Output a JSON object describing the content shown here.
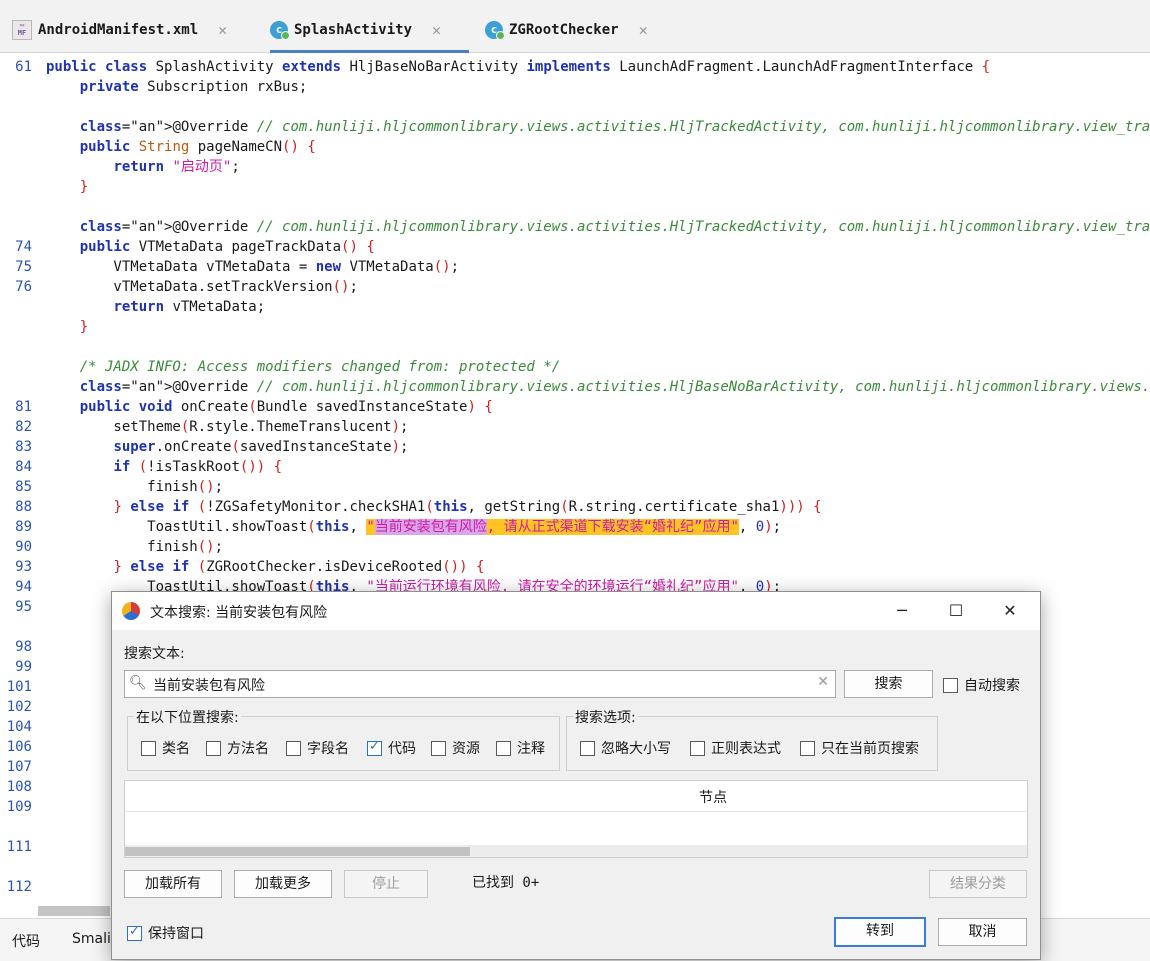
{
  "tabs": [
    {
      "label": "AndroidManifest.xml",
      "icon": "manifest-file-icon",
      "active": false
    },
    {
      "label": "SplashActivity",
      "icon": "class-file-icon",
      "active": true
    },
    {
      "label": "ZGRootChecker",
      "icon": "class-file-icon",
      "active": false
    }
  ],
  "code": {
    "lines": [
      {
        "n": "61",
        "t": "public class SplashActivity extends HljBaseNoBarActivity implements LaunchAdFragment.LaunchAdFragmentInterface {"
      },
      {
        "n": "",
        "t": "    private Subscription rxBus;"
      },
      {
        "n": "",
        "t": ""
      },
      {
        "n": "",
        "t": "    @Override // com.hunliji.hljcommonlibrary.views.activities.HljTrackedActivity, com.hunliji.hljcommonlibrary.view_tracke"
      },
      {
        "n": "",
        "t": "    public String pageNameCN() {"
      },
      {
        "n": "",
        "t": "        return \"启动页\";"
      },
      {
        "n": "",
        "t": "    }"
      },
      {
        "n": "",
        "t": ""
      },
      {
        "n": "",
        "t": "    @Override // com.hunliji.hljcommonlibrary.views.activities.HljTrackedActivity, com.hunliji.hljcommonlibrary.view_tracke"
      },
      {
        "n": "74",
        "t": "    public VTMetaData pageTrackData() {"
      },
      {
        "n": "75",
        "t": "        VTMetaData vTMetaData = new VTMetaData();"
      },
      {
        "n": "76",
        "t": "        vTMetaData.setTrackVersion();"
      },
      {
        "n": "",
        "t": "        return vTMetaData;"
      },
      {
        "n": "",
        "t": "    }"
      },
      {
        "n": "",
        "t": ""
      },
      {
        "n": "",
        "t": "    /* JADX INFO: Access modifiers changed from: protected */"
      },
      {
        "n": "",
        "t": "    @Override // com.hunliji.hljcommonlibrary.views.activities.HljBaseNoBarActivity, com.hunliji.hljcommonlibrary.views.act"
      },
      {
        "n": "81",
        "t": "    public void onCreate(Bundle savedInstanceState) {"
      },
      {
        "n": "82",
        "t": "        setTheme(R.style.ThemeTranslucent);"
      },
      {
        "n": "83",
        "t": "        super.onCreate(savedInstanceState);"
      },
      {
        "n": "84",
        "t": "        if (!isTaskRoot()) {"
      },
      {
        "n": "85",
        "t": "            finish();"
      },
      {
        "n": "88",
        "t": "        } else if (!ZGSafetyMonitor.checkSHA1(this, getString(R.string.certificate_sha1))) {"
      },
      {
        "n": "89",
        "t": "            ToastUtil.showToast(this, \"当前安装包有风险, 请从正式渠道下载安装“婚礼纪”应用\", 0);"
      },
      {
        "n": "90",
        "t": "            finish();"
      },
      {
        "n": "93",
        "t": "        } else if (ZGRootChecker.isDeviceRooted()) {"
      },
      {
        "n": "94",
        "t": "            ToastUtil.showToast(this, \"当前运行环境有风险, 请在安全的环境运行“婚礼纪”应用\", 0);"
      },
      {
        "n": "95",
        "t": ""
      }
    ],
    "gutter_only": [
      "98",
      "99",
      "101",
      "102",
      "104",
      "106",
      "107",
      "108",
      "109",
      "111",
      "112"
    ]
  },
  "bottom_tabs": [
    "代码",
    "Smali"
  ],
  "dialog": {
    "title": "文本搜索: 当前安装包有风险",
    "search_label": "搜索文本:",
    "search_value": "当前安装包有风险",
    "search_button": "搜索",
    "auto_search": {
      "label": "自动搜索",
      "checked": false
    },
    "location_group": "在以下位置搜索:",
    "locations": [
      {
        "label": "类名",
        "checked": false
      },
      {
        "label": "方法名",
        "checked": false
      },
      {
        "label": "字段名",
        "checked": false
      },
      {
        "label": "代码",
        "checked": true
      },
      {
        "label": "资源",
        "checked": false
      },
      {
        "label": "注释",
        "checked": false
      }
    ],
    "options_group": "搜索选项:",
    "options": [
      {
        "label": "忽略大小写",
        "checked": false
      },
      {
        "label": "正则表达式",
        "checked": false
      },
      {
        "label": "只在当前页搜索",
        "checked": false
      }
    ],
    "results_header": "节点",
    "load_all": "加载所有",
    "load_more": "加载更多",
    "stop": "停止",
    "found": "已找到  0+",
    "group_results": "结果分类",
    "keep_window": {
      "label": "保持窗口",
      "checked": true
    },
    "goto": "转到",
    "cancel": "取消"
  },
  "colors": {
    "keyword": "#1f32b4",
    "string": "#d21aa8",
    "comment": "#3a8a3a",
    "highlight": "#ffc422",
    "accent": "#2c6fd1"
  }
}
